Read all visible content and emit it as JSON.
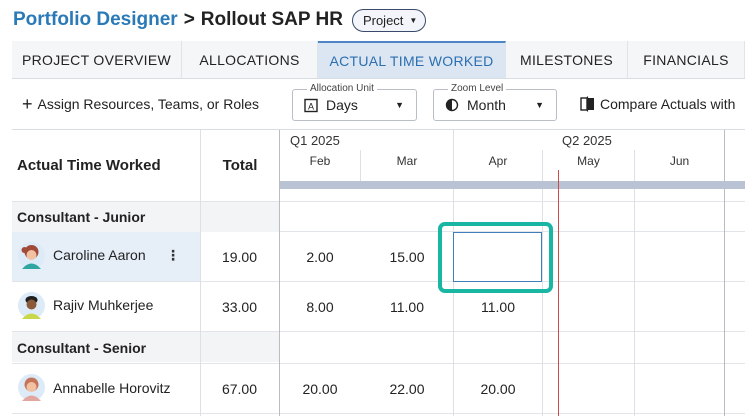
{
  "breadcrumb": {
    "parent": "Portfolio Designer",
    "separator": ">",
    "current": "Rollout SAP HR"
  },
  "type_selector": {
    "value": "Project"
  },
  "tabs": [
    {
      "label": "PROJECT OVERVIEW",
      "active": false
    },
    {
      "label": "ALLOCATIONS",
      "active": false
    },
    {
      "label": "ACTUAL TIME WORKED",
      "active": true
    },
    {
      "label": "MILESTONES",
      "active": false
    },
    {
      "label": "FINANCIALS",
      "active": false
    }
  ],
  "toolbar": {
    "assign_label": "Assign Resources, Teams, or Roles",
    "allocation_unit": {
      "legend": "Allocation Unit",
      "value": "Days",
      "icon": "calendar-icon"
    },
    "zoom_level": {
      "legend": "Zoom Level",
      "value": "Month",
      "icon": "half-circle-icon"
    },
    "compare_label": "Compare Actuals with"
  },
  "grid": {
    "title": "Actual Time Worked",
    "total_header": "Total",
    "quarters": [
      "Q1 2025",
      "Q2 2025"
    ],
    "months": [
      "Feb",
      "Mar",
      "Apr",
      "May",
      "Jun"
    ],
    "groups": [
      {
        "label": "Consultant - Junior",
        "people": [
          {
            "name": "Caroline Aaron",
            "total": "19.00",
            "values": [
              "2.00",
              "15.00",
              "",
              "",
              ""
            ]
          },
          {
            "name": "Rajiv Muhkerjee",
            "total": "33.00",
            "values": [
              "8.00",
              "11.00",
              "11.00",
              "",
              ""
            ]
          }
        ]
      },
      {
        "label": "Consultant - Senior",
        "people": [
          {
            "name": "Annabelle Horovitz",
            "total": "67.00",
            "values": [
              "20.00",
              "22.00",
              "20.00",
              "",
              ""
            ]
          }
        ]
      }
    ]
  },
  "colors": {
    "accent": "#2a7ab8",
    "active_tab_bg": "#dbe6f2",
    "focus_outline": "#19b7a3",
    "today_line": "#cf4a4a",
    "timeline_bar": "#b9c3d3"
  }
}
